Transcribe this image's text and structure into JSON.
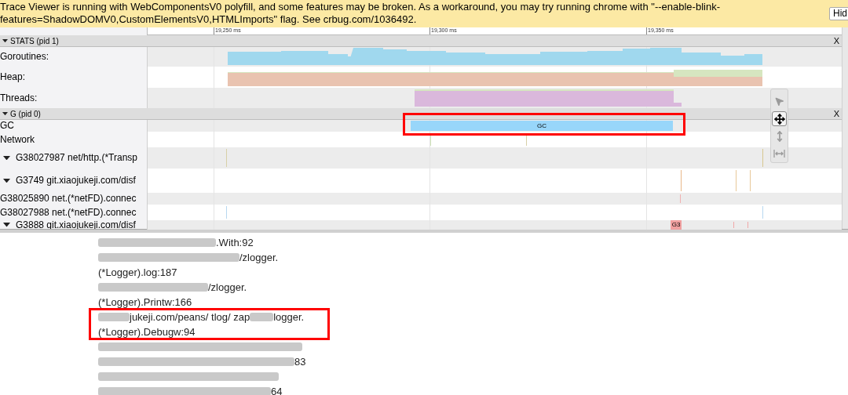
{
  "banner": {
    "text": "Trace Viewer is running with WebComponentsV0 polyfill, and some features may be broken. As a workaround, you may try running chrome with \"--enable-blink-features=ShadowDOMV0,CustomElementsV0,HTMLImports\" flag. See crbug.com/1036492.",
    "button": "Hid"
  },
  "ruler": {
    "ticks": [
      "19,250 ms",
      "19,300 ms",
      "19,350 ms"
    ]
  },
  "sections": [
    {
      "title": "STATS (pid 1)",
      "expanded": true,
      "close": "X",
      "tracks": [
        {
          "label": "Goroutines:",
          "kind": "counter_area",
          "expanded": false
        },
        {
          "label": "Heap:",
          "kind": "heap_area",
          "expanded": false
        },
        {
          "label": "Threads:",
          "kind": "threads_area",
          "expanded": false
        }
      ]
    },
    {
      "title": "G (pid 0)",
      "expanded": true,
      "close": "X",
      "tracks": [
        {
          "label": "GC",
          "kind": "slice",
          "slice_label": "GC",
          "highlighted": true,
          "expanded": false
        },
        {
          "label": "Network",
          "kind": "ticks",
          "expanded": false
        },
        {
          "label": "G38027987 net/http.(*Transp",
          "kind": "ticks",
          "expanded": true
        },
        {
          "label": "G3749 git.xiaojukeji.com/disf",
          "kind": "ticks",
          "expanded": true
        },
        {
          "label": "G38025890 net.(*netFD).connec",
          "kind": "ticks",
          "expanded": false
        },
        {
          "label": "G38027988 net.(*netFD).connec",
          "kind": "ticks",
          "expanded": false
        },
        {
          "label": "G3888 git.xiaojukeji.com/disf",
          "kind": "slice_small",
          "slice_label": "G3",
          "expanded": true
        }
      ]
    }
  ],
  "toolbar": [
    {
      "kind": "select",
      "selected": false
    },
    {
      "kind": "pan",
      "selected": true
    },
    {
      "kind": "zoom",
      "selected": false
    },
    {
      "kind": "timing",
      "selected": false
    }
  ],
  "stack": [
    {
      "highlighted": false,
      "lines": [
        {
          "parts": [
            {
              "kind": "blur"
            },
            {
              "kind": "text",
              "text": ".With:92"
            }
          ]
        }
      ]
    },
    {
      "highlighted": false,
      "lines": [
        {
          "parts": [
            {
              "kind": "blur"
            },
            {
              "kind": "text",
              "text": "/zlogger."
            }
          ]
        },
        {
          "parts": [
            {
              "kind": "text",
              "text": "(*Logger).log:187"
            }
          ]
        }
      ]
    },
    {
      "highlighted": false,
      "lines": [
        {
          "parts": [
            {
              "kind": "blur"
            },
            {
              "kind": "text",
              "text": "/zlogger."
            }
          ]
        },
        {
          "parts": [
            {
              "kind": "text",
              "text": "(*Logger).Printw:166"
            }
          ]
        }
      ]
    },
    {
      "highlighted": true,
      "lines": [
        {
          "parts": [
            {
              "kind": "blur"
            },
            {
              "kind": "text",
              "text": "jukeji.com/peans/ tlog/ zap"
            },
            {
              "kind": "blur"
            },
            {
              "kind": "text",
              "text": "logger."
            }
          ]
        },
        {
          "parts": [
            {
              "kind": "text",
              "text": "(*Logger).Debugw:94"
            }
          ]
        }
      ]
    },
    {
      "highlighted": false,
      "lines": [
        {
          "parts": [
            {
              "kind": "blur"
            }
          ]
        },
        {
          "parts": [
            {
              "kind": "blur"
            },
            {
              "kind": "text",
              "text": "83"
            }
          ]
        }
      ]
    },
    {
      "highlighted": false,
      "lines": [
        {
          "parts": [
            {
              "kind": "blur"
            }
          ]
        },
        {
          "parts": [
            {
              "kind": "blur"
            },
            {
              "kind": "text",
              "text": "64"
            }
          ]
        }
      ]
    }
  ]
}
